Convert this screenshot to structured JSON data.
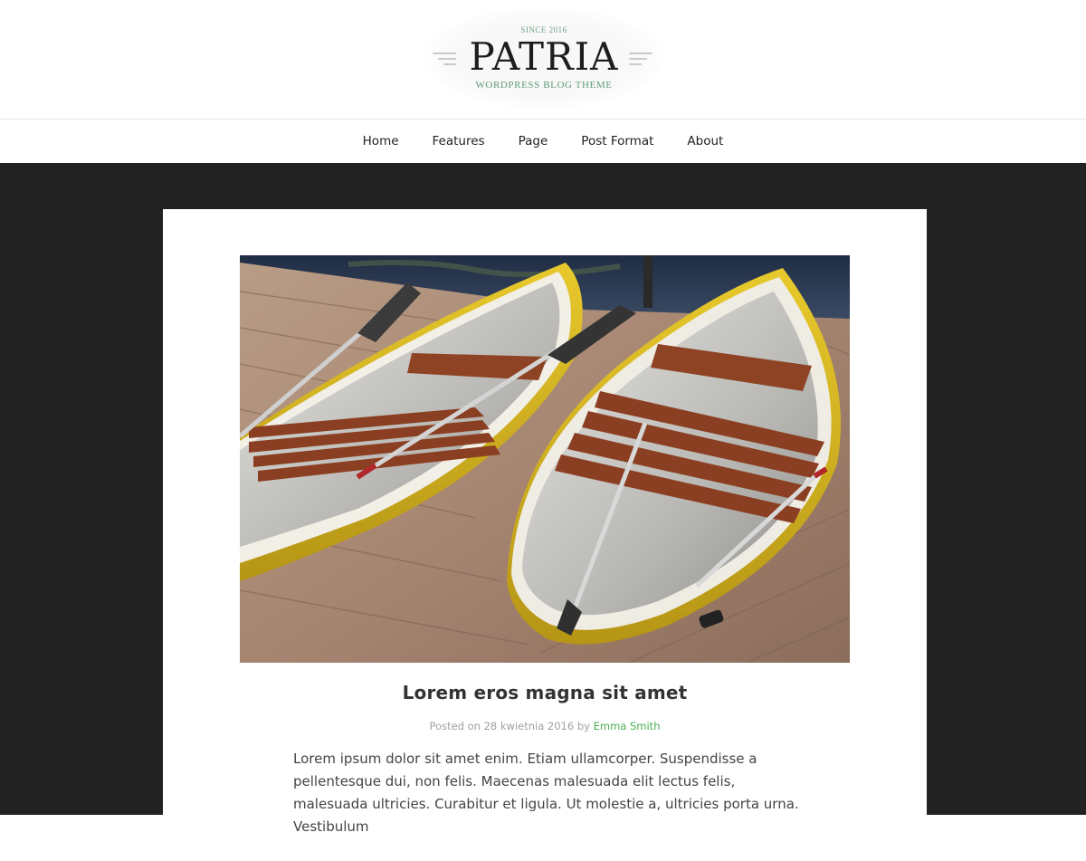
{
  "logo": {
    "since": "SINCE 2016",
    "name": "PATRIA",
    "tagline": "WORDPRESS BLOG THEME"
  },
  "nav": {
    "items": [
      {
        "label": "Home"
      },
      {
        "label": "Features"
      },
      {
        "label": "Page"
      },
      {
        "label": "Post Format"
      },
      {
        "label": "About"
      }
    ]
  },
  "post": {
    "image_subject": "two rowing boats with oars on a wooden dock",
    "title": "Lorem eros magna sit amet",
    "meta": {
      "posted_on_label": "Posted on",
      "date": "28 kwietnia 2016",
      "by_label": "by",
      "author": "Emma Smith"
    },
    "excerpt": "Lorem ipsum dolor sit amet enim. Etiam ullamcorper. Suspendisse a pellentesque dui, non felis. Maecenas malesuada elit lectus felis, malesuada ultricies. Curabitur et ligula. Ut molestie a, ultricies porta urna. Vestibulum"
  },
  "colors": {
    "page_background": "#222222",
    "card_background": "#ffffff",
    "accent_green": "#4caf50",
    "logo_green": "#5e9a79",
    "boat_yellow": "#e0c024",
    "bench_wood": "#8b3f22"
  }
}
